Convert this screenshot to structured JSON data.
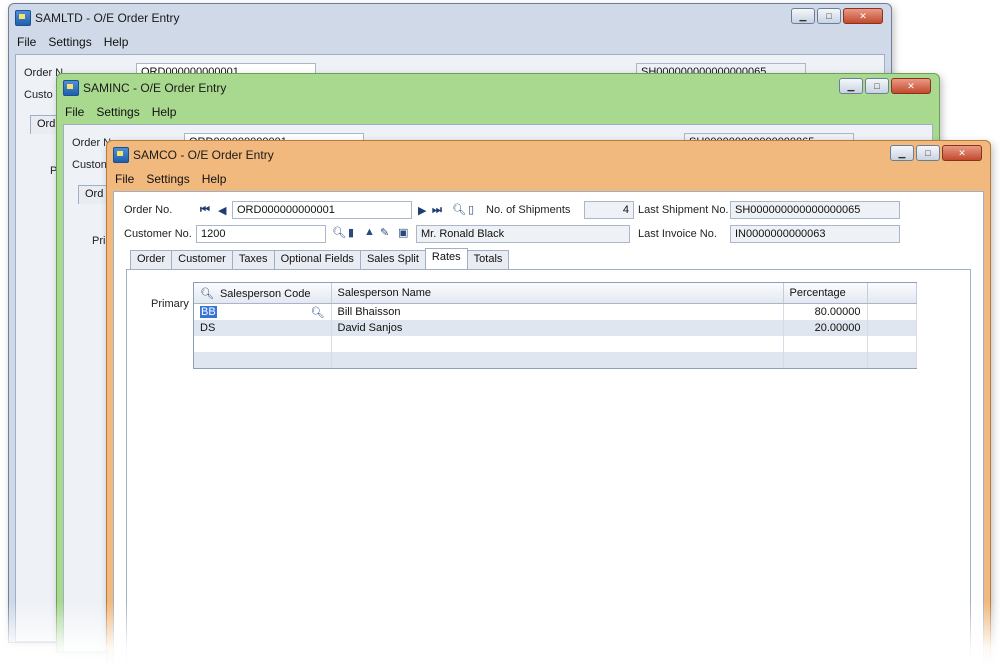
{
  "windows": {
    "back": {
      "title": "SAMLTD - O/E Order Entry",
      "menu": [
        "File",
        "Settings",
        "Help"
      ],
      "peek": {
        "order_label": "Order N",
        "customer_label": "Custo",
        "tab": "Ord",
        "primary": "Pri",
        "order_no": "ORD000000000001",
        "last_shipment": "SH000000000000000065"
      }
    },
    "middle": {
      "title": "SAMINC - O/E Order Entry",
      "menu": [
        "File",
        "Settings",
        "Help"
      ],
      "peek": {
        "order_label": "Order N",
        "customer_label": "Custon",
        "tab": "Ord",
        "primary": "Pri",
        "order_no": "ORD000000000001",
        "last_shipment": "SH000000000000000065"
      }
    },
    "front": {
      "title": "SAMCO - O/E Order Entry",
      "menu": [
        "File",
        "Settings",
        "Help"
      ],
      "fields": {
        "order_no_label": "Order No.",
        "order_no": "ORD000000000001",
        "shipments_label": "No. of Shipments",
        "shipments_value": "4",
        "last_shipment_label": "Last Shipment No.",
        "last_shipment_value": "SH000000000000000065",
        "customer_no_label": "Customer No.",
        "customer_no": "1200",
        "customer_name": "Mr. Ronald Black",
        "last_invoice_label": "Last Invoice No.",
        "last_invoice_value": "IN0000000000063"
      },
      "tabs": [
        "Order",
        "Customer",
        "Taxes",
        "Optional Fields",
        "Sales Split",
        "Rates",
        "Totals"
      ],
      "active_tab": "Rates",
      "primary_label": "Primary",
      "grid": {
        "columns": [
          "Salesperson Code",
          "Salesperson Name",
          "Percentage"
        ],
        "rows": [
          {
            "code": "BB",
            "name": "Bill Bhaisson",
            "pct": "80.00000"
          },
          {
            "code": "DS",
            "name": "David Sanjos",
            "pct": "20.00000"
          }
        ]
      }
    }
  },
  "colors": {
    "back_frame": "#cfd9e8",
    "middle_frame": "#a9d98e",
    "front_frame": "#f1b97d",
    "selection": "#3875d7"
  }
}
